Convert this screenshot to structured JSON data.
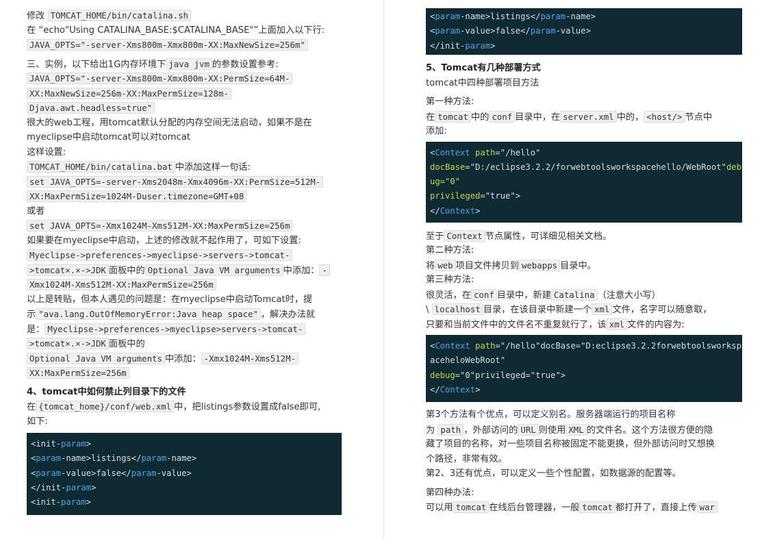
{
  "left": {
    "l1": [
      "修改 ",
      "TOMCAT_HOME/bin/catalina.sh"
    ],
    "l2": [
      "在 “echo\"Using CATALINA_BASE:$CATALINA_BASE\"”上面加入以下行:"
    ],
    "l3": "JAVA_OPTS=\"-server-Xms800m-Xmx800m-XX:MaxNewSize=256m\"",
    "l4": [
      "三、实例，以下给出1G内存环境下",
      "java jvm",
      "的参数设置参考:"
    ],
    "l5": "JAVA_OPTS=\"-server-Xms800m-Xmx800m-XX:PermSize=64M-",
    "l6": "XX:MaxNewSize=256m-XX:MaxPermSize=128m-",
    "l7": "Djava.awt.headless=true\"",
    "l8": "很大的web工程，用tomcat默认分配的内存空间无法启动，如果不是在",
    "l9": "myeclipse中启动tomcat可以对tomcat",
    "l10": "这样设置:",
    "l11": [
      "TOMCAT_HOME/bin/catalina.bat",
      "中添加这样一句话:"
    ],
    "l12": "set JAVA_OPTS=-server-Xms2048m-Xmx4096m-XX:PermSize=512M-",
    "l13": "XX:MaxPermSize=1024M-Duser.timezone=GMT+08",
    "l14": "或者",
    "l15": "set JAVA_OPTS=-Xmx1024M-Xms512M-XX:MaxPermSize=256m",
    "l16": "如果要在myeclipse中启动，上述的修改就不起作用了，可如下设置:",
    "l17": "Myeclipse->preferences->myeclipse->servers->tomcat-",
    "l18": [
      ">tomcat×.×->JDK",
      "面板中的",
      "Optional Java VM arguments",
      "中添加：",
      "-"
    ],
    "l19": "Xmx1024M-Xms512M-XX:MaxPermSize=256m",
    "l20": "以上是转贴，但本人遇见的问题是：在myeclipse中启动Tomcat时，提",
    "l21": [
      "示",
      "\"ava.lang.OutOfMemoryError:Java heap space\"",
      "，解决办法就"
    ],
    "l22": [
      "是：",
      "Myeclipse->preferences->myeclipse>servers->tomcat-"
    ],
    "l23": [
      ">tomcat×.×->JDK",
      "面板中的"
    ],
    "l24": [
      "Optional Java VM arguments",
      "中添加：",
      "-Xmx1024M-Xms512M-"
    ],
    "l25": "XX:MaxPermSize=256m",
    "h4": "4、tomcat中如何禁止列目录下的文件",
    "l26": [
      "在",
      "{tomcat_home}/conf/web.xml",
      "中，把listings参数设置成false即可,"
    ],
    "l27": "如下:",
    "code": {
      "c1": [
        "<init-",
        "param",
        ">"
      ],
      "c2": [
        "<",
        "param",
        "-name>listings</",
        "param",
        "-name>"
      ],
      "c3": [
        "<",
        "param",
        "-value>false</",
        "param",
        "-value>"
      ],
      "c4": [
        "</init-",
        "param",
        ">"
      ],
      "c5": [
        "<init-",
        "param",
        ">"
      ]
    }
  },
  "right": {
    "codeTop": {
      "c1": [
        "<",
        "param",
        "-name>listings</",
        "param",
        "-name>"
      ],
      "c2": [
        "<",
        "param",
        "-value>false</",
        "param",
        "-value>"
      ],
      "c3": [
        "</init-",
        "param",
        ">"
      ]
    },
    "h5": "5、Tomcat有几种部署方式",
    "r1": "tomcat中四种部署项目方法",
    "r2": "第一种方法:",
    "r3": [
      "在",
      "tomcat",
      "中的",
      "conf",
      "目录中，在",
      "server.xml",
      "中的，",
      "<host/>",
      "节点中"
    ],
    "r4": "添加:",
    "code2": {
      "c1": [
        "<",
        "Context",
        " path",
        "=",
        "\"/hello\""
      ],
      "c2a": [
        "docBase",
        "=",
        "\"D:/eclipse3.2.2/forwebtoolsworkspacehello/WebRoot\"",
        "deb"
      ],
      "c2b": "ug=\"0\"",
      "c3": [
        "privileged",
        "=",
        "\"true\"",
        ">"
      ],
      "c4": [
        "</",
        "Context",
        ">"
      ]
    },
    "r5": [
      "至于",
      "Context",
      "节点属性，可详细见相关文档。"
    ],
    "r6": "第二种方法:",
    "r7": [
      "将",
      "web",
      "项目文件拷贝到",
      "webapps",
      "目录中。"
    ],
    "r8": "第三种方法:",
    "r9": [
      "很灵活，在",
      "conf",
      "目录中，新建",
      "Catalina",
      "（注意大小写）"
    ],
    "r10": [
      "\\",
      "localhost",
      "目录，在该目录中新建一个",
      "xml",
      "文件，名字可以随意取，"
    ],
    "r11": [
      "只要和当前文件中的文件名不重复就行了，该",
      "xml",
      "文件的内容为:"
    ],
    "code3": {
      "c1": [
        "<",
        "Context",
        " path",
        "=",
        "\"/hello\"docBase=\"D:eclipse3.2.2forwebtoolsworksp"
      ],
      "c2": "aceheloWebRoot\"",
      "c3": [
        "debug",
        "=",
        "\"0\"privileged=\"true\"",
        ">"
      ],
      "c4": [
        "</",
        "Context",
        ">"
      ]
    },
    "r12": "第3个方法有个优点，可以定义别名。服务器端运行的项目名称",
    "r13": [
      "为",
      "path",
      "，外部访问的",
      "URL",
      "则使用",
      "XML",
      "的文件名。这个方法很方便的隐"
    ],
    "r14": "藏了项目的名称，对一些项目名称被固定不能更换，但外部访问时又想换",
    "r15": "个路径，非常有效。",
    "r16": "第2、3还有优点，可以定义一些个性配置，如数据源的配置等。",
    "r17": "第四种办法:",
    "r18": [
      "可以用",
      "tomcat",
      "在线后台管理器，一般",
      "tomcat",
      "都打开了，直接上传",
      "war"
    ]
  }
}
